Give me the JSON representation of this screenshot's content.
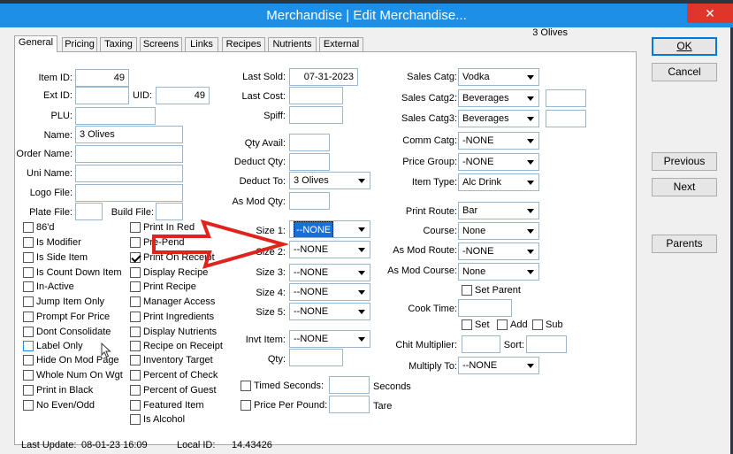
{
  "window": {
    "title": "Merchandise | Edit Merchandise...",
    "close_glyph": "✕"
  },
  "tabs": [
    "General",
    "Pricing",
    "Taxing",
    "Screens",
    "Links",
    "Recipes",
    "Nutrients",
    "External"
  ],
  "header_item_name": "3 Olives",
  "buttons": {
    "ok": "OK",
    "cancel": "Cancel",
    "previous": "Previous",
    "next": "Next",
    "parents": "Parents"
  },
  "left": {
    "item_id": {
      "label": "Item ID:",
      "value": "49"
    },
    "ext_id": {
      "label": "Ext ID:",
      "value": ""
    },
    "uid": {
      "label": "UID:",
      "value": "49"
    },
    "plu": {
      "label": "PLU:",
      "value": ""
    },
    "name": {
      "label": "Name:",
      "value": "3 Olives"
    },
    "order_name": {
      "label": "Order Name:",
      "value": ""
    },
    "uni_name": {
      "label": "Uni Name:",
      "value": ""
    },
    "logo_file": {
      "label": "Logo File:",
      "value": ""
    },
    "plate_file": {
      "label": "Plate File:",
      "value": ""
    },
    "build_file": {
      "label": "Build File:",
      "value": ""
    }
  },
  "checkboxes_col1": [
    {
      "label": "86'd",
      "checked": false
    },
    {
      "label": "Is Modifier",
      "checked": false
    },
    {
      "label": "Is Side Item",
      "checked": false
    },
    {
      "label": "Is Count Down Item",
      "checked": false
    },
    {
      "label": "In-Active",
      "checked": false
    },
    {
      "label": "Jump Item Only",
      "checked": false
    },
    {
      "label": "Prompt For Price",
      "checked": false
    },
    {
      "label": "Dont Consolidate",
      "checked": false
    },
    {
      "label": "Label Only",
      "checked": false
    },
    {
      "label": "Hide On Mod Page",
      "checked": false
    },
    {
      "label": "Whole Num On Wgt",
      "checked": false
    },
    {
      "label": "Print in Black",
      "checked": false
    },
    {
      "label": "No Even/Odd",
      "checked": false
    }
  ],
  "checkboxes_col2": [
    {
      "label": "Print In Red",
      "checked": false
    },
    {
      "label": "Pre-Pend",
      "checked": false
    },
    {
      "label": "Print On Receipt",
      "checked": true
    },
    {
      "label": "Display Recipe",
      "checked": false
    },
    {
      "label": "Print Recipe",
      "checked": false
    },
    {
      "label": "Manager Access",
      "checked": false
    },
    {
      "label": "Print Ingredients",
      "checked": false
    },
    {
      "label": "Display Nutrients",
      "checked": false
    },
    {
      "label": "Recipe on Receipt",
      "checked": false
    },
    {
      "label": "Inventory Target",
      "checked": false
    },
    {
      "label": "Percent of Check",
      "checked": false
    },
    {
      "label": "Percent of Guest",
      "checked": false
    },
    {
      "label": "Featured Item",
      "checked": false
    },
    {
      "label": "Is Alcohol",
      "checked": false
    }
  ],
  "middle": {
    "last_sold": {
      "label": "Last Sold:",
      "value": "07-31-2023"
    },
    "last_cost": {
      "label": "Last Cost:",
      "value": ""
    },
    "spiff": {
      "label": "Spiff:",
      "value": ""
    },
    "qty_avail": {
      "label": "Qty Avail:",
      "value": ""
    },
    "deduct_qty": {
      "label": "Deduct Qty:",
      "value": ""
    },
    "deduct_to": {
      "label": "Deduct To:",
      "value": "3 Olives"
    },
    "as_mod_qty": {
      "label": "As Mod Qty:",
      "value": ""
    },
    "size1": {
      "label": "Size 1:",
      "value": "--NONE"
    },
    "size2": {
      "label": "Size 2:",
      "value": "--NONE"
    },
    "size3": {
      "label": "Size 3:",
      "value": "--NONE"
    },
    "size4": {
      "label": "Size 4:",
      "value": "--NONE"
    },
    "size5": {
      "label": "Size 5:",
      "value": "--NONE"
    },
    "invt_item": {
      "label": "Invt Item:",
      "value": "--NONE"
    },
    "qty": {
      "label": "Qty:",
      "value": ""
    },
    "timed_seconds": {
      "label": "Timed Seconds:",
      "suffix": "Seconds",
      "value": ""
    },
    "price_per_pound": {
      "label": "Price Per Pound:",
      "suffix": "Tare",
      "value": ""
    }
  },
  "right": {
    "sales_catg": {
      "label": "Sales Catg:",
      "value": "Vodka"
    },
    "sales_catg2": {
      "label": "Sales Catg2:",
      "value": "Beverages"
    },
    "sales_catg3": {
      "label": "Sales Catg3:",
      "value": "Beverages"
    },
    "comm_catg": {
      "label": "Comm Catg:",
      "value": "-NONE"
    },
    "price_group": {
      "label": "Price Group:",
      "value": "-NONE"
    },
    "item_type": {
      "label": "Item Type:",
      "value": "Alc Drink"
    },
    "print_route": {
      "label": "Print Route:",
      "value": "Bar"
    },
    "course": {
      "label": "Course:",
      "value": "None"
    },
    "as_mod_route": {
      "label": "As Mod Route:",
      "value": "-NONE"
    },
    "as_mod_course": {
      "label": "As Mod Course:",
      "value": "None"
    },
    "set_parent": {
      "label": "Set Parent",
      "checked": false
    },
    "cook_time": {
      "label": "Cook Time:",
      "value": ""
    },
    "set": {
      "label": "Set",
      "checked": false
    },
    "add": {
      "label": "Add",
      "checked": false
    },
    "sub": {
      "label": "Sub",
      "checked": false
    },
    "chit_multiplier": {
      "label": "Chit Multiplier:",
      "value": ""
    },
    "sort": {
      "label": "Sort:",
      "value": ""
    },
    "multiply_to": {
      "label": "Multiply To:",
      "value": "--NONE"
    }
  },
  "footer": {
    "last_update_label": "Last Update:",
    "last_update": "08-01-23 16:09",
    "local_id_label": "Local ID:",
    "local_id": "14.43426"
  },
  "colors": {
    "titlebar": "#1e8fe6",
    "close": "#e0352b",
    "annotation_arrow": "#e0231c",
    "selection": "#1a6fd6"
  }
}
